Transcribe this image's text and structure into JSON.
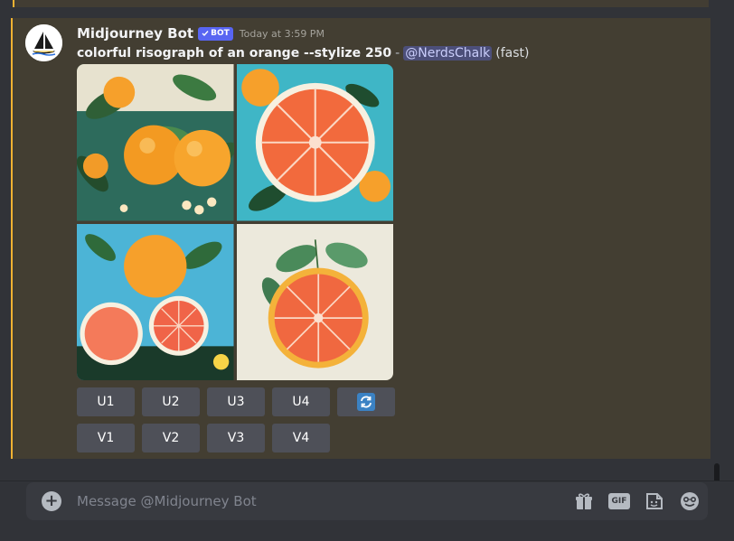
{
  "message": {
    "username": "Midjourney Bot",
    "badge": "BOT",
    "timestamp": "Today at 3:59 PM",
    "prompt": "colorful risograph of an orange --stylize 250",
    "separator": "-",
    "mention": "@NerdsChalk",
    "speed": "(fast)"
  },
  "buttons": {
    "upscale": [
      "U1",
      "U2",
      "U3",
      "U4"
    ],
    "variation": [
      "V1",
      "V2",
      "V3",
      "V4"
    ],
    "reroll_icon": "refresh-icon"
  },
  "composer": {
    "placeholder": "Message @Midjourney Bot",
    "gif_label": "GIF",
    "icons": [
      "plus-icon",
      "gift-icon",
      "gif-icon",
      "sticker-icon",
      "emoji-icon"
    ]
  },
  "colors": {
    "highlight_bar": "#f0b232",
    "highlight_bg": "#433e32",
    "bot_badge": "#5865f2",
    "button_bg": "#4e5058",
    "mention_bg": "#4c4f7a"
  }
}
